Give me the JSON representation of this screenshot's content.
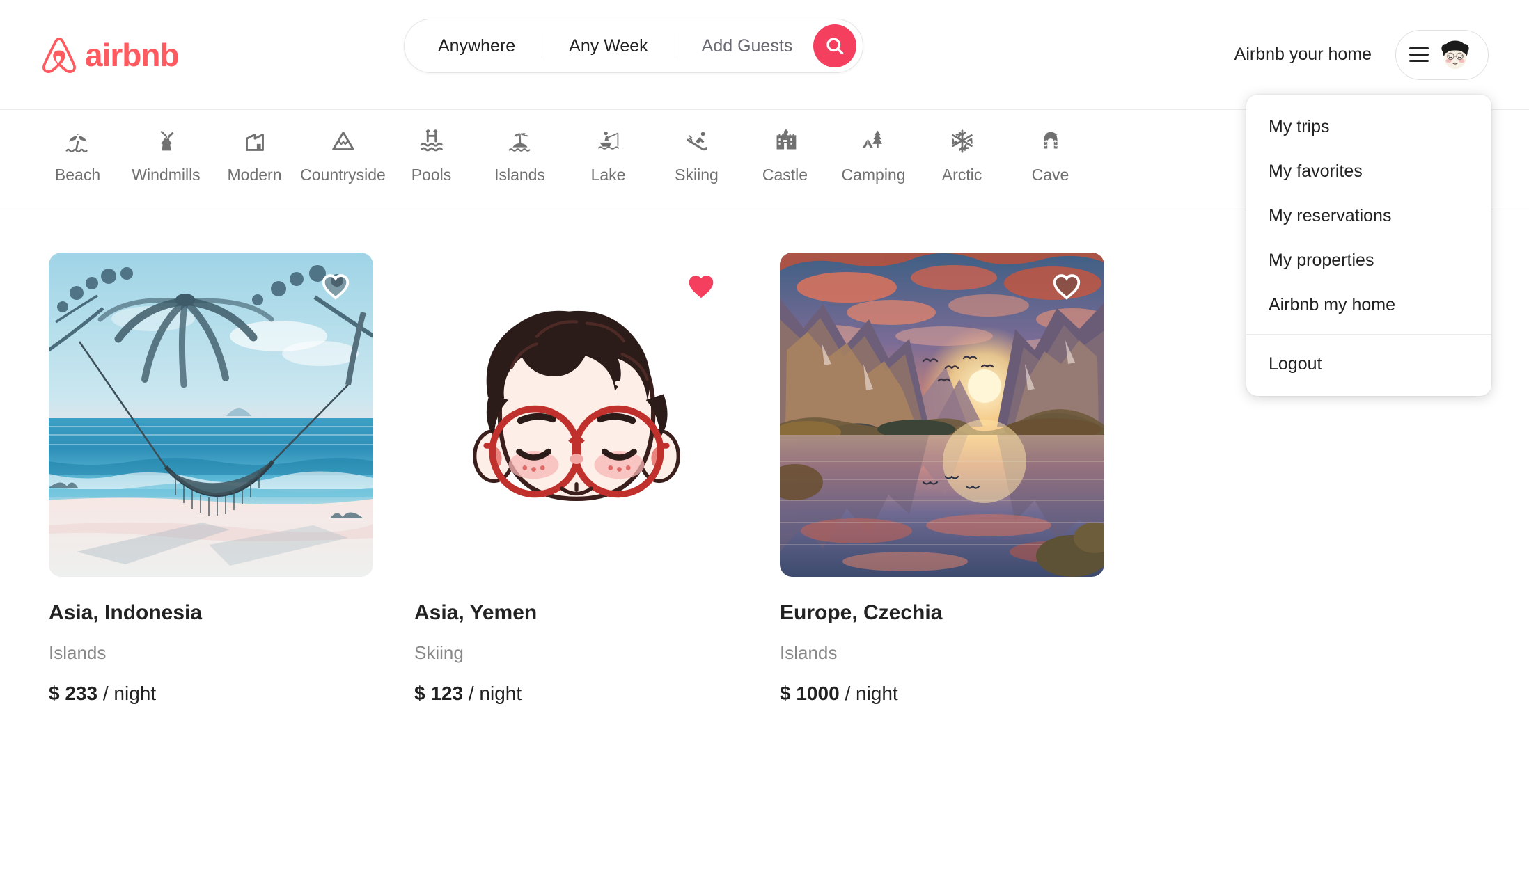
{
  "brand": {
    "name": "airbnb",
    "accent": "#FF5A5F",
    "search_button_color": "#F43F5E",
    "heart_active_color": "#F43F5E"
  },
  "search": {
    "location": "Anywhere",
    "dates": "Any Week",
    "guests": "Add Guests",
    "search_icon": "search-icon"
  },
  "header": {
    "host_link": "Airbnb your home",
    "menu_icon": "hamburger-icon",
    "avatar_icon": "user-avatar"
  },
  "user_menu": {
    "items": [
      {
        "label": "My trips"
      },
      {
        "label": "My favorites"
      },
      {
        "label": "My reservations"
      },
      {
        "label": "My properties"
      },
      {
        "label": "Airbnb my home"
      }
    ],
    "logout": "Logout"
  },
  "categories": [
    {
      "label": "Beach",
      "icon": "beach-umbrella-icon"
    },
    {
      "label": "Windmills",
      "icon": "windmill-icon"
    },
    {
      "label": "Modern",
      "icon": "modern-building-icon"
    },
    {
      "label": "Countryside",
      "icon": "mountain-icon"
    },
    {
      "label": "Pools",
      "icon": "pool-icon"
    },
    {
      "label": "Islands",
      "icon": "island-palm-icon"
    },
    {
      "label": "Lake",
      "icon": "fishing-boat-icon"
    },
    {
      "label": "Skiing",
      "icon": "skier-icon"
    },
    {
      "label": "Castle",
      "icon": "castle-icon"
    },
    {
      "label": "Camping",
      "icon": "tent-tree-icon"
    },
    {
      "label": "Arctic",
      "icon": "snowflake-icon"
    },
    {
      "label": "Cave",
      "icon": "cave-icon"
    }
  ],
  "listings": [
    {
      "title": "Asia, Indonesia",
      "category": "Islands",
      "currency": "$",
      "price": "233",
      "per": "/ night",
      "favorited": false,
      "image": "watercolor-beach-hammock-palm"
    },
    {
      "title": "Asia, Yemen",
      "category": "Skiing",
      "currency": "$",
      "price": "123",
      "per": "/ night",
      "favorited": true,
      "image": "cartoon-boy-glasses-avatar"
    },
    {
      "title": "Europe, Czechia",
      "category": "Islands",
      "currency": "$",
      "price": "1000",
      "per": "/ night",
      "favorited": false,
      "image": "sunset-mountain-lake"
    }
  ]
}
